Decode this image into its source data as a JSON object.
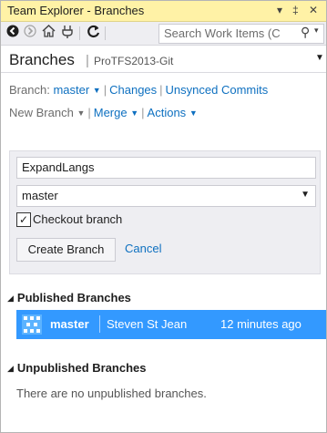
{
  "window": {
    "title": "Team Explorer - Branches",
    "pin_glyph": "▾ ‡ ✕"
  },
  "toolbar": {
    "search_placeholder": "Search Work Items (C"
  },
  "header": {
    "title": "Branches",
    "project": "ProTFS2013-Git"
  },
  "nav": {
    "branch_label": "Branch:",
    "branch_value": "master",
    "changes": "Changes",
    "unsynced": "Unsynced Commits",
    "new_branch": "New Branch",
    "merge": "Merge",
    "actions": "Actions"
  },
  "new_branch_form": {
    "name_value": "ExpandLangs",
    "source_value": "master",
    "checkout_label": "Checkout branch",
    "checkout_checked": true,
    "create_label": "Create Branch",
    "cancel_label": "Cancel"
  },
  "published": {
    "heading": "Published Branches",
    "branches": [
      {
        "name": "master",
        "author": "Steven St Jean",
        "time": "12 minutes ago"
      }
    ]
  },
  "unpublished": {
    "heading": "Unpublished Branches",
    "empty_text": "There are no unpublished branches."
  },
  "colors": {
    "title_bar": "#fff2a6",
    "link": "#0e70c0",
    "selection": "#3399ff"
  }
}
